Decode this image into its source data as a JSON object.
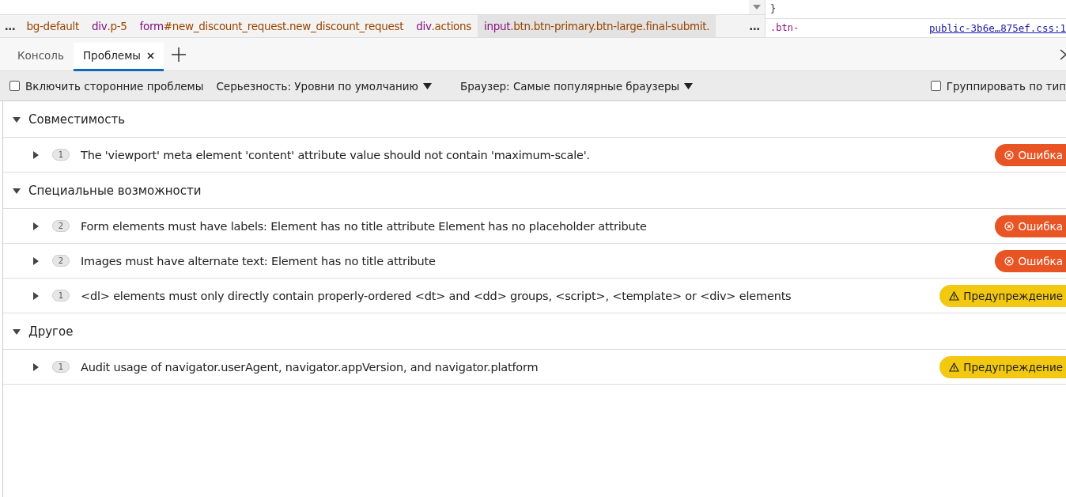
{
  "breadcrumbs": [
    {
      "rest": "bg-default",
      "selected": false
    },
    {
      "tag": "div",
      "rest": ".p-5",
      "selected": false
    },
    {
      "tag": "form",
      "rest": "#new_discount_request.new_discount_request",
      "selected": false
    },
    {
      "tag": "div",
      "rest": ".actions",
      "selected": false
    },
    {
      "tag": "input",
      "rest": ".btn.btn-primary.btn-large.final-submit.",
      "selected": true
    }
  ],
  "breadcrumb_more": "…",
  "breadcrumb_more_right": "…",
  "styles": {
    "brace": "}",
    "selector": ".btn-",
    "source": "public-3b6e…875ef.css:1"
  },
  "tabs": [
    {
      "label": "Консоль",
      "selected": false,
      "closable": false
    },
    {
      "label": "Проблемы",
      "selected": true,
      "closable": true
    }
  ],
  "toolbar": {
    "third_party": {
      "label": "Включить сторонние проблемы",
      "checked": false
    },
    "severity": "Серьезность: Уровни по умолчанию",
    "browser": "Браузер: Самые популярные браузеры",
    "group": {
      "label": "Группировать по тип",
      "checked": false
    }
  },
  "sections": [
    {
      "title": "Совместимость",
      "expanded": true,
      "issues": [
        {
          "count": "1",
          "text": "The 'viewport' meta element 'content' attribute value should not contain 'maximum-scale'.",
          "kind": "error",
          "badge": "Ошибка"
        }
      ]
    },
    {
      "title": "Специальные возможности",
      "expanded": true,
      "issues": [
        {
          "count": "2",
          "text": "Form elements must have labels: Element has no title attribute Element has no placeholder attribute",
          "kind": "error",
          "badge": "Ошибка"
        },
        {
          "count": "2",
          "text": "Images must have alternate text: Element has no title attribute",
          "kind": "error",
          "badge": "Ошибка"
        },
        {
          "count": "1",
          "text": "<dl> elements must only directly contain properly-ordered <dt> and <dd> groups, <script>, <template> or <div> elements",
          "kind": "warning",
          "badge": "Предупреждение"
        }
      ]
    },
    {
      "title": "Другое",
      "expanded": true,
      "issues": [
        {
          "count": "1",
          "text": "Audit usage of navigator.userAgent, navigator.appVersion, and navigator.platform",
          "kind": "warning",
          "badge": "Предупреждение"
        }
      ]
    }
  ]
}
